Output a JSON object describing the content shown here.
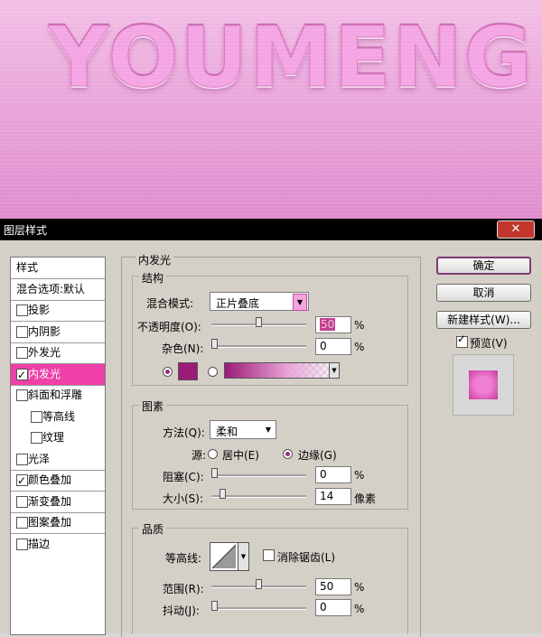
{
  "canvas": {
    "text": "YOUMENG"
  },
  "window": {
    "title": "图层样式",
    "close": "✕"
  },
  "styles_panel": {
    "header": "样式",
    "blend_default": "混合选项:默认",
    "items": [
      {
        "label": "投影",
        "checked": false
      },
      {
        "label": "内阴影",
        "checked": false
      },
      {
        "label": "外发光",
        "checked": false
      },
      {
        "label": "内发光",
        "checked": true,
        "active": true
      },
      {
        "label": "斜面和浮雕",
        "checked": false
      },
      {
        "label": "等高线",
        "checked": false,
        "sub": true
      },
      {
        "label": "纹理",
        "checked": false,
        "sub": true
      },
      {
        "label": "光泽",
        "checked": false
      },
      {
        "label": "颜色叠加",
        "checked": true
      },
      {
        "label": "渐变叠加",
        "checked": false
      },
      {
        "label": "图案叠加",
        "checked": false
      },
      {
        "label": "描边",
        "checked": false
      }
    ]
  },
  "inner_glow": {
    "title": "内发光",
    "structure": {
      "title": "结构",
      "blend_mode_label": "混合模式:",
      "blend_mode_value": "正片叠底",
      "opacity_label": "不透明度(O):",
      "opacity_value": "50",
      "opacity_percent": 0.5,
      "noise_label": "杂色(N):",
      "noise_value": "0",
      "noise_percent": 0.0,
      "percent": "%",
      "glow_color": "#9b1b77"
    },
    "elements": {
      "title": "图素",
      "method_label": "方法(Q):",
      "method_value": "柔和",
      "source_label": "源:",
      "center_label": "居中(E)",
      "edge_label": "边缘(G)",
      "choke_label": "阻塞(C):",
      "choke_value": "0",
      "choke_percent": 0.0,
      "size_label": "大小(S):",
      "size_value": "14",
      "size_unit": "像素",
      "percent": "%"
    },
    "quality": {
      "title": "品质",
      "contour_label": "等高线:",
      "antialias_label": "消除锯齿(L)",
      "range_label": "范围(R):",
      "range_value": "50",
      "range_percent": 0.5,
      "jitter_label": "抖动(J):",
      "jitter_value": "0",
      "jitter_percent": 0.0,
      "percent": "%"
    }
  },
  "buttons": {
    "ok": "确定",
    "cancel": "取消",
    "new_style": "新建样式(W)...",
    "preview_label": "预览(V)",
    "preview_checked": true
  },
  "colors": {
    "accent": "#ef3fa8",
    "preview_swatch": "#f07fd3"
  }
}
